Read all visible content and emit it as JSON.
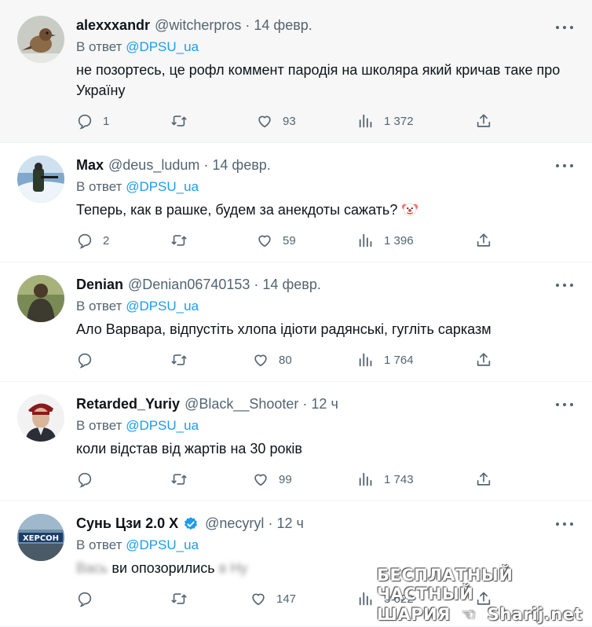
{
  "tweets": [
    {
      "name": "alexxxandr",
      "handle": "@witcherpros",
      "time": "14 февр.",
      "reply_prefix": "В ответ",
      "reply_to": "@DPSU_ua",
      "text": "не позортесь, це рофл коммент пародія на школяра який кричав таке про Україну",
      "replies": "1",
      "retweets": "",
      "likes": "93",
      "views": "1 372"
    },
    {
      "name": "Max",
      "handle": "@deus_ludum",
      "time": "14 февр.",
      "reply_prefix": "В ответ",
      "reply_to": "@DPSU_ua",
      "text": "Теперь, как в рашке, будем за анекдоты сажать?",
      "replies": "2",
      "retweets": "",
      "likes": "59",
      "views": "1 396"
    },
    {
      "name": "Denian",
      "handle": "@Denian06740153",
      "time": "14 февр.",
      "reply_prefix": "В ответ",
      "reply_to": "@DPSU_ua",
      "text": "Ало Варвара, відпустіть хлопа ідіоти радянські, гугліть сарказм",
      "replies": "",
      "retweets": "",
      "likes": "80",
      "views": "1 764"
    },
    {
      "name": "Retarded_Yuriy",
      "handle": "@Black__Shooter",
      "time": "12 ч",
      "reply_prefix": "В ответ",
      "reply_to": "@DPSU_ua",
      "text": "коли відстав від жартів на 30 років",
      "replies": "",
      "retweets": "",
      "likes": "99",
      "views": "1 743"
    },
    {
      "name": "Сунь Цзи 2.0 Х",
      "handle": "@necyryl",
      "time": "12 ч",
      "reply_prefix": "В ответ",
      "reply_to": "@DPSU_ua",
      "text_blur_a": "Вась",
      "text": "ви опозорились",
      "text_blur_b": "в Ну",
      "replies": "",
      "retweets": "",
      "likes": "147",
      "views": "3 622"
    }
  ],
  "avatar_banner_text": "ХЕРСОН",
  "watermark": {
    "line1": "БЕСПЛАТНЫЙ ЧАСТНЫЙ",
    "line2a": "ШАРИЯ",
    "line2b": "Sharij.net"
  },
  "icons": [
    "reply-icon",
    "retweet-icon",
    "like-icon",
    "views-icon",
    "share-icon",
    "more-icon",
    "verified-icon",
    "clown-emoji"
  ],
  "colors": {
    "accent": "#1d9bf0",
    "muted": "#536471",
    "text": "#0f1419"
  }
}
